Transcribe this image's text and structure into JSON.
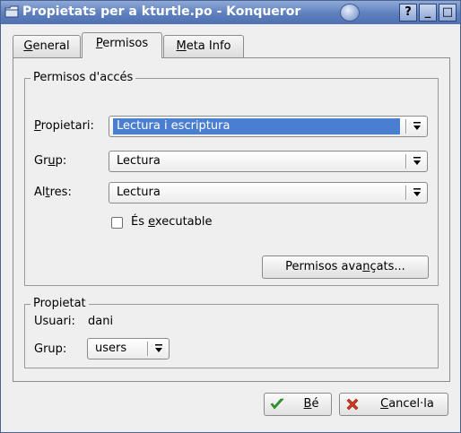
{
  "window": {
    "title": "Propietats per a kturtle.po - Konqueror",
    "buttons": {
      "help": "?",
      "minimize": "_",
      "maximize": "□"
    }
  },
  "tabs": [
    {
      "label_pre": "",
      "label_u": "G",
      "label_post": "eneral"
    },
    {
      "label_pre": "",
      "label_u": "P",
      "label_post": "ermisos"
    },
    {
      "label_pre": "",
      "label_u": "M",
      "label_post": "eta Info"
    }
  ],
  "access": {
    "legend": "Permisos d'accés",
    "owner": {
      "label_pre": "",
      "label_u": "P",
      "label_post": "ropietari:",
      "value": "Lectura i escriptura"
    },
    "group": {
      "label_pre": "Gr",
      "label_u": "u",
      "label_post": "p:",
      "value": "Lectura"
    },
    "others": {
      "label_pre": "Al",
      "label_u": "t",
      "label_post": "res:",
      "value": "Lectura"
    },
    "executable": {
      "label_pre": "És ",
      "label_u": "e",
      "label_post": "xecutable",
      "checked": false
    },
    "advanced": {
      "label_pre": "Permisos ava",
      "label_u": "n",
      "label_post": "çats..."
    }
  },
  "ownership": {
    "legend": "Propietat",
    "user_label": "Usuari:",
    "user_value": "dani",
    "group_label": "Grup:",
    "group_value": "users"
  },
  "footer": {
    "ok": {
      "label_pre": "",
      "label_u": "B",
      "label_post": "é"
    },
    "cancel": {
      "label_pre": "",
      "label_u": "C",
      "label_post": "ancel·la"
    }
  },
  "colors": {
    "titlebar": "#5d7fbe",
    "selection": "#4a7fd0",
    "ok_icon": "#2aa52a",
    "cancel_icon": "#d23a1e"
  }
}
